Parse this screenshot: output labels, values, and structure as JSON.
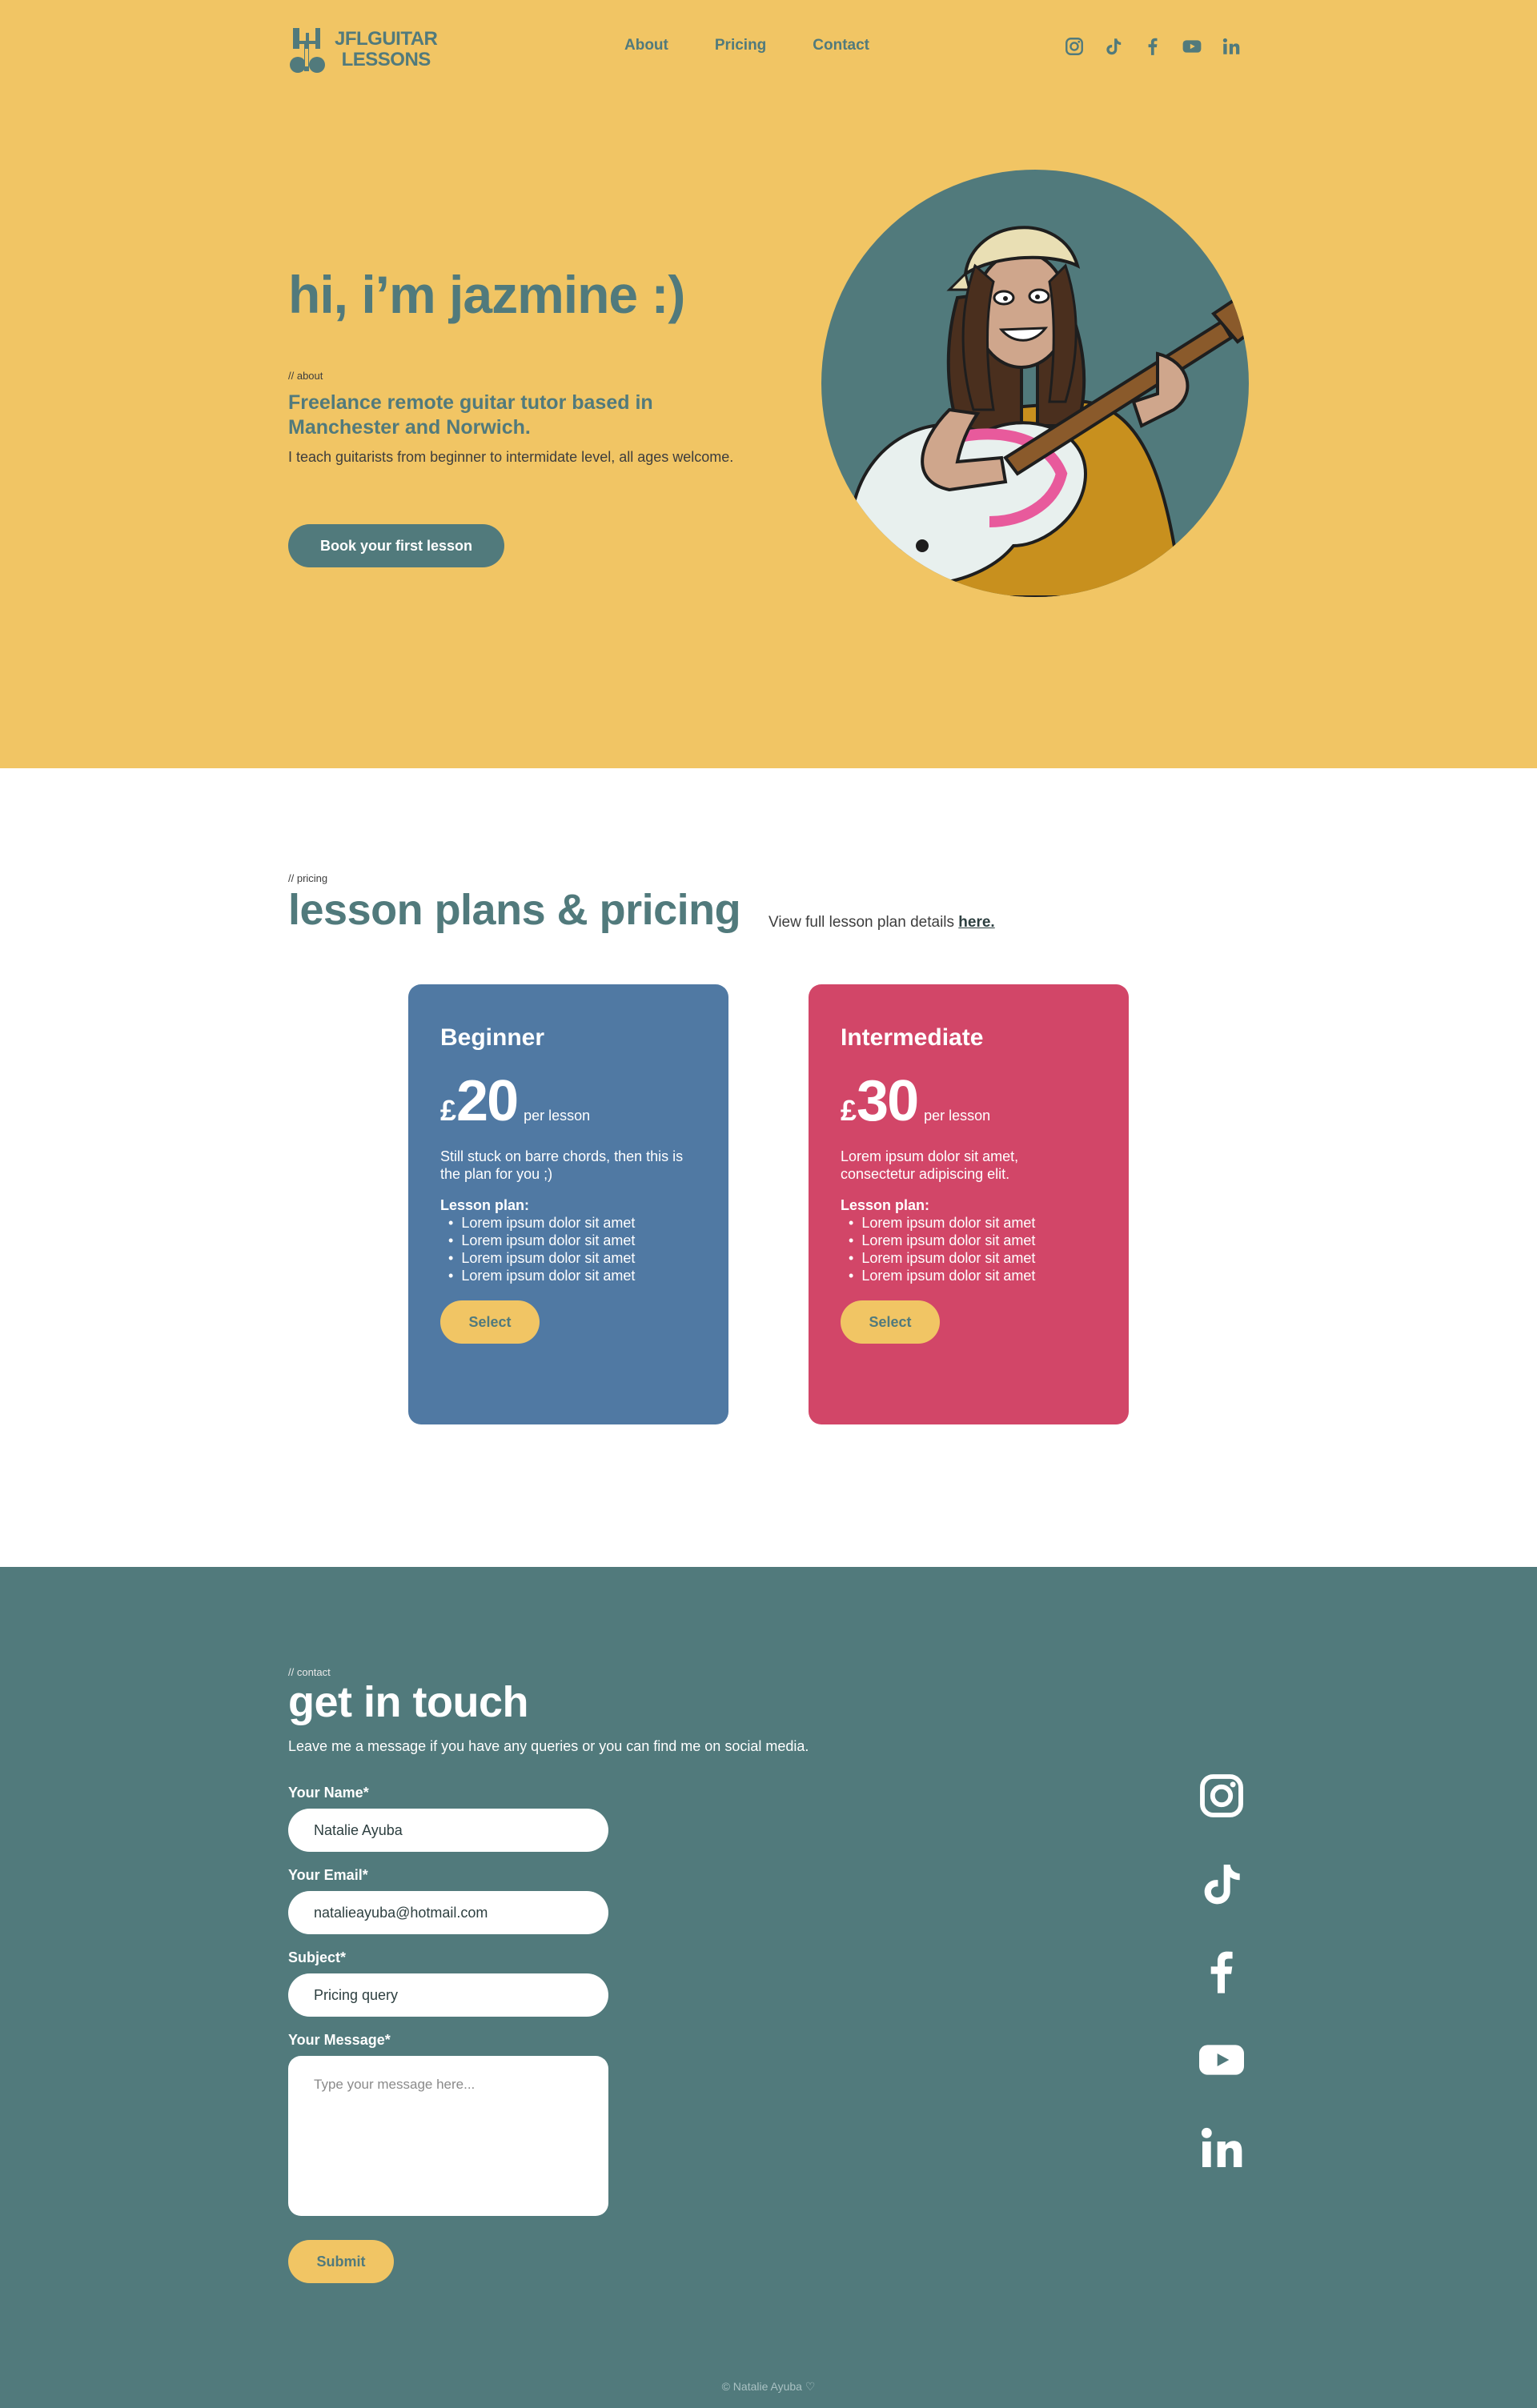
{
  "brand": {
    "line1": "JFLGUITAR",
    "line2": "LESSONS"
  },
  "nav": [
    {
      "label": "About"
    },
    {
      "label": "Pricing"
    },
    {
      "label": "Contact"
    }
  ],
  "social_icons": [
    "instagram-icon",
    "tiktok-icon",
    "facebook-icon",
    "youtube-icon",
    "linkedin-icon"
  ],
  "hero": {
    "title": "hi, i’m jazmine :)",
    "tag": "// about",
    "lead": "Freelance remote guitar tutor based in Manchester and Norwich.",
    "body": "I teach guitarists from beginner to intermidate level, all ages welcome.",
    "cta": "Book your first lesson"
  },
  "pricing": {
    "tag": "// pricing",
    "title": "lesson plans & pricing",
    "note": "View full lesson plan details",
    "note_link": "here.",
    "plans": [
      {
        "name": "Beginner",
        "currency": "£",
        "amount": "20",
        "per": "per lesson",
        "desc": "Still stuck on barre chords, then this is the plan for you ;)",
        "plan_heading": "Lesson plan:",
        "items": [
          "Lorem ipsum dolor sit amet",
          "Lorem ipsum dolor sit amet",
          "Lorem ipsum dolor sit amet",
          "Lorem ipsum dolor sit amet"
        ],
        "button": "Select"
      },
      {
        "name": "Intermediate",
        "currency": "£",
        "amount": "30",
        "per": "per lesson",
        "desc": "Lorem ipsum dolor sit amet, consectetur adipiscing elit.",
        "plan_heading": "Lesson plan:",
        "items": [
          "Lorem ipsum dolor sit amet",
          "Lorem ipsum dolor sit amet",
          "Lorem ipsum dolor sit amet",
          "Lorem ipsum dolor sit amet"
        ],
        "button": "Select"
      }
    ]
  },
  "contact": {
    "tag": "// contact",
    "title": "get in touch",
    "subtitle": "Leave me a message if you have any queries or you can find me on social media.",
    "name_label": "Your Name*",
    "name_value": "Natalie Ayuba",
    "email_label": "Your Email*",
    "email_value": "natalieayuba@hotmail.com",
    "subject_label": "Subject*",
    "subject_value": "Pricing query",
    "message_label": "Your Message*",
    "message_placeholder": "Type your message here...",
    "submit": "Submit"
  },
  "footer": {
    "text": "© Natalie Ayuba ♡"
  },
  "colors": {
    "yellow": "#f1c564",
    "teal": "#517a7c",
    "blue_card": "#5079a3",
    "pink_card": "#d24668"
  }
}
